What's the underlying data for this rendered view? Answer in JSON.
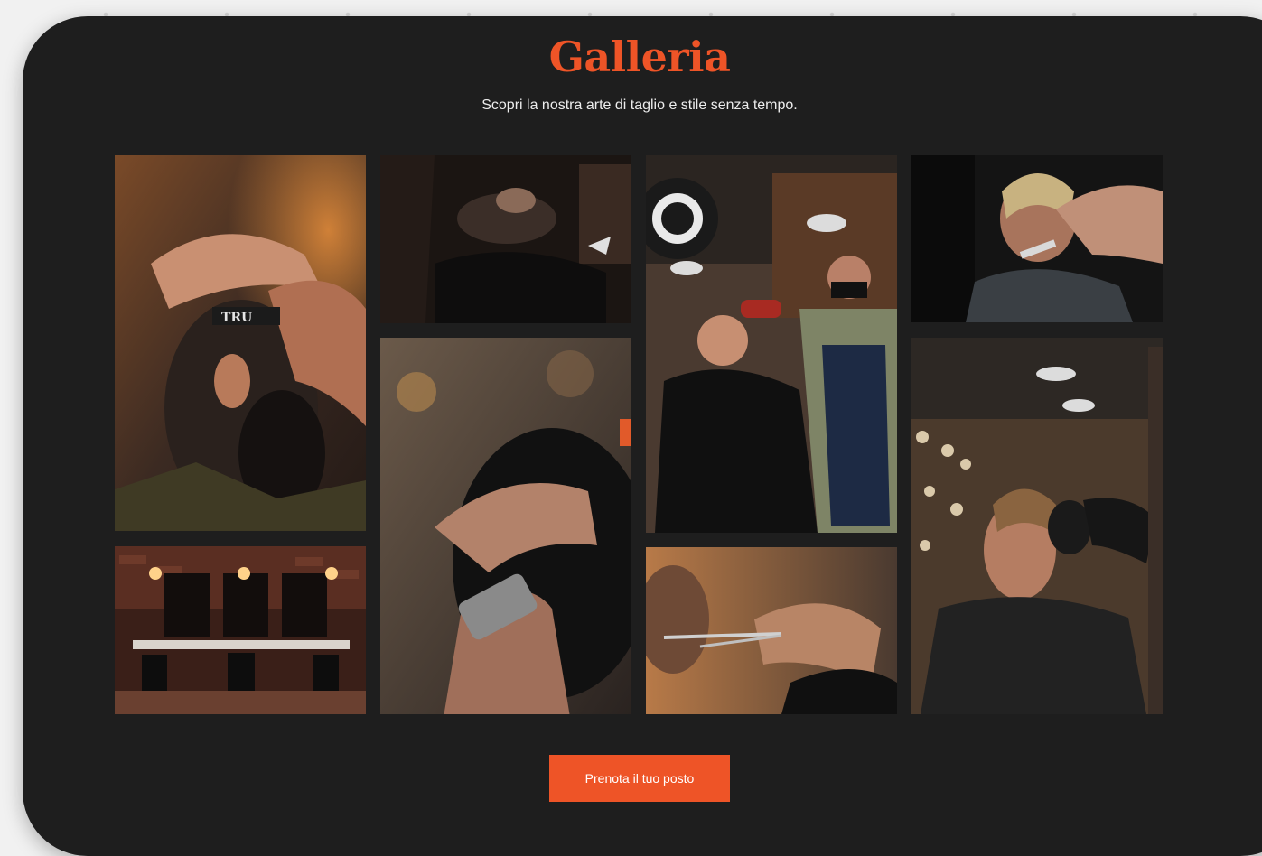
{
  "gallery": {
    "title": "Galleria",
    "subtitle": "Scopri la nostra arte di taglio e stile senza tempo.",
    "photos": [
      {
        "name": "photo-razor-fade",
        "caption": "TRU"
      },
      {
        "name": "photo-barbershop-interior"
      },
      {
        "name": "photo-hot-towel-shave"
      },
      {
        "name": "photo-clipper-trim"
      },
      {
        "name": "photo-blow-dry-masked-barber"
      },
      {
        "name": "photo-scissors-cut"
      },
      {
        "name": "photo-neck-razor"
      },
      {
        "name": "photo-blow-dry-client"
      }
    ]
  },
  "cta": {
    "label": "Prenota il tuo posto"
  },
  "colors": {
    "accent": "#ee5427",
    "panel_bg": "#1e1e1e",
    "page_bg": "#f1f1f1",
    "text_light": "#ededed"
  }
}
